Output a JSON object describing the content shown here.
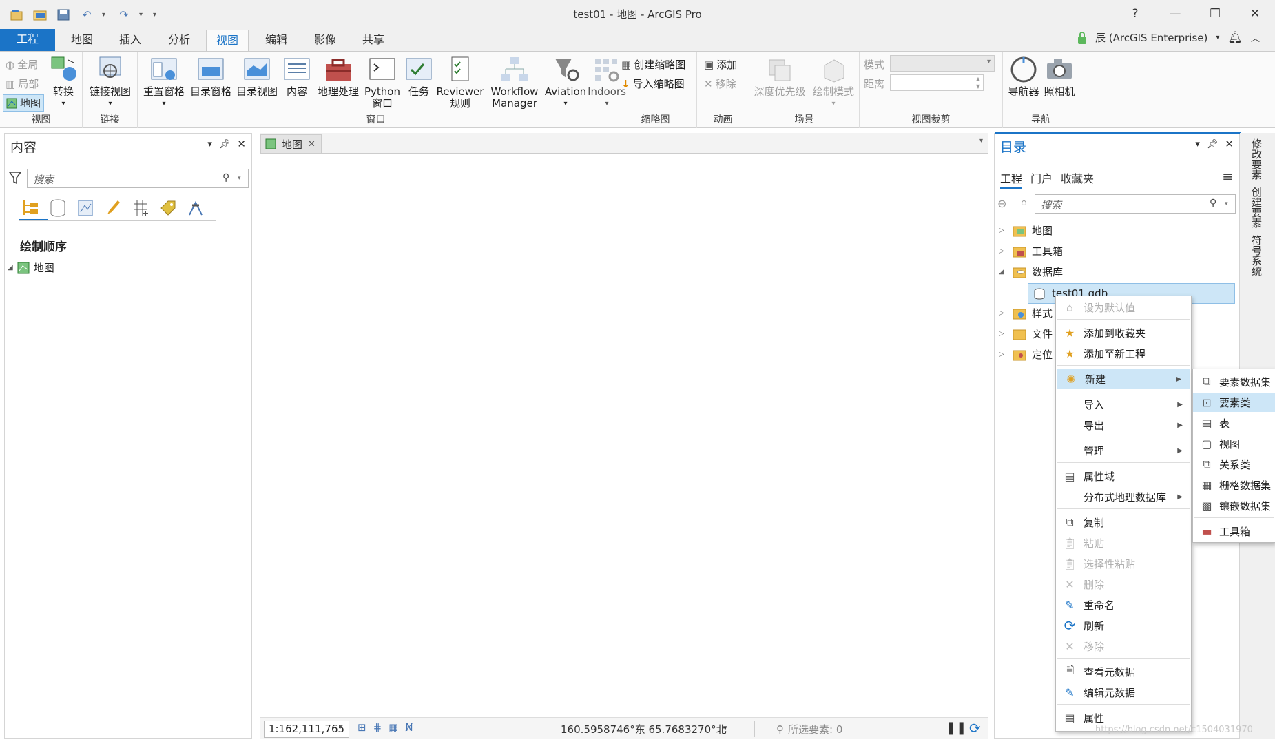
{
  "window": {
    "title": "test01 - 地图 - ArcGIS Pro",
    "help": "?"
  },
  "tabs": [
    "工程",
    "地图",
    "插入",
    "分析",
    "视图",
    "编辑",
    "影像",
    "共享"
  ],
  "user": {
    "name": "辰 (ArcGIS Enterprise)"
  },
  "ribbon": {
    "view_group": {
      "global": "全局",
      "local": "局部",
      "map": "地图",
      "convert": "转换",
      "label": "视图"
    },
    "link_group": {
      "link_views": "链接视图",
      "label": "链接"
    },
    "window_group": {
      "reset_panes": "重置窗格",
      "catalog_pane": "目录窗格",
      "catalog_view": "目录视图",
      "contents": "内容",
      "geoprocessing": "地理处理",
      "python1": "Python",
      "python2": "窗口",
      "tasks": "任务",
      "reviewer1": "Reviewer",
      "reviewer2": "规则",
      "workflow1": "Workflow",
      "workflow2": "Manager",
      "aviation": "Aviation",
      "indoors": "Indoors",
      "label": "窗口"
    },
    "thumbnail_group": {
      "create": "创建缩略图",
      "import": "导入缩略图",
      "label": "缩略图"
    },
    "animation_group": {
      "add": "添加",
      "remove": "移除",
      "label": "动画"
    },
    "scene_group": {
      "depth": "深度优先级",
      "draw_mode": "绘制模式",
      "label": "场景"
    },
    "clip_group": {
      "mode": "模式",
      "distance": "距离",
      "label": "视图裁剪"
    },
    "nav_group": {
      "navigator": "导航器",
      "camera": "照相机",
      "label": "导航"
    }
  },
  "contents": {
    "title": "内容",
    "search_placeholder": "搜索",
    "section": "绘制顺序",
    "map_item": "地图"
  },
  "map": {
    "tab_label": "地图",
    "scale": "1:162,111,765",
    "coords": "160.5958746°东 65.7683270°北",
    "selected": "所选要素: 0"
  },
  "catalog": {
    "title": "目录",
    "tabs": [
      "工程",
      "门户",
      "收藏夹"
    ],
    "search_placeholder": "搜索",
    "items": [
      {
        "label": "地图",
        "icon": "map-folder-icon"
      },
      {
        "label": "工具箱",
        "icon": "toolbox-folder-icon"
      },
      {
        "label": "数据库",
        "icon": "database-folder-icon"
      },
      {
        "label": "test01.gdb",
        "icon": "geodatabase-icon"
      },
      {
        "label": "样式",
        "icon": "style-folder-icon"
      },
      {
        "label": "文件",
        "icon": "files-folder-icon"
      },
      {
        "label": "定位",
        "icon": "locator-folder-icon"
      }
    ]
  },
  "context_menu": {
    "items": [
      {
        "label": "设为默认值",
        "disabled": true,
        "icon": "home-icon"
      },
      {
        "label": "添加到收藏夹",
        "icon": "star-icon"
      },
      {
        "label": "添加至新工程",
        "icon": "star-icon"
      },
      {
        "label": "新建",
        "submenu": true,
        "icon": "new-icon"
      },
      {
        "label": "导入",
        "submenu": true
      },
      {
        "label": "导出",
        "submenu": true
      },
      {
        "label": "管理",
        "submenu": true
      },
      {
        "label": "属性域",
        "icon": "domains-icon"
      },
      {
        "label": "分布式地理数据库",
        "submenu": true
      },
      {
        "label": "复制",
        "icon": "copy-icon"
      },
      {
        "label": "粘贴",
        "disabled": true,
        "icon": "paste-icon"
      },
      {
        "label": "选择性粘贴",
        "disabled": true,
        "icon": "paste-special-icon"
      },
      {
        "label": "删除",
        "disabled": true,
        "icon": "delete-icon"
      },
      {
        "label": "重命名",
        "icon": "rename-icon"
      },
      {
        "label": "刷新",
        "icon": "refresh-icon"
      },
      {
        "label": "移除",
        "disabled": true,
        "icon": "remove-icon"
      },
      {
        "label": "查看元数据",
        "icon": "view-metadata-icon"
      },
      {
        "label": "编辑元数据",
        "icon": "edit-metadata-icon"
      },
      {
        "label": "属性",
        "icon": "properties-icon"
      }
    ]
  },
  "submenu": {
    "items": [
      "要素数据集",
      "要素类",
      "表",
      "视图",
      "关系类",
      "栅格数据集",
      "镶嵌数据集",
      "工具箱"
    ]
  },
  "side_tabs": [
    "修改要素",
    "创建要素",
    "符号系统"
  ],
  "watermark": "https://blog.csdn.net/c1504031970"
}
